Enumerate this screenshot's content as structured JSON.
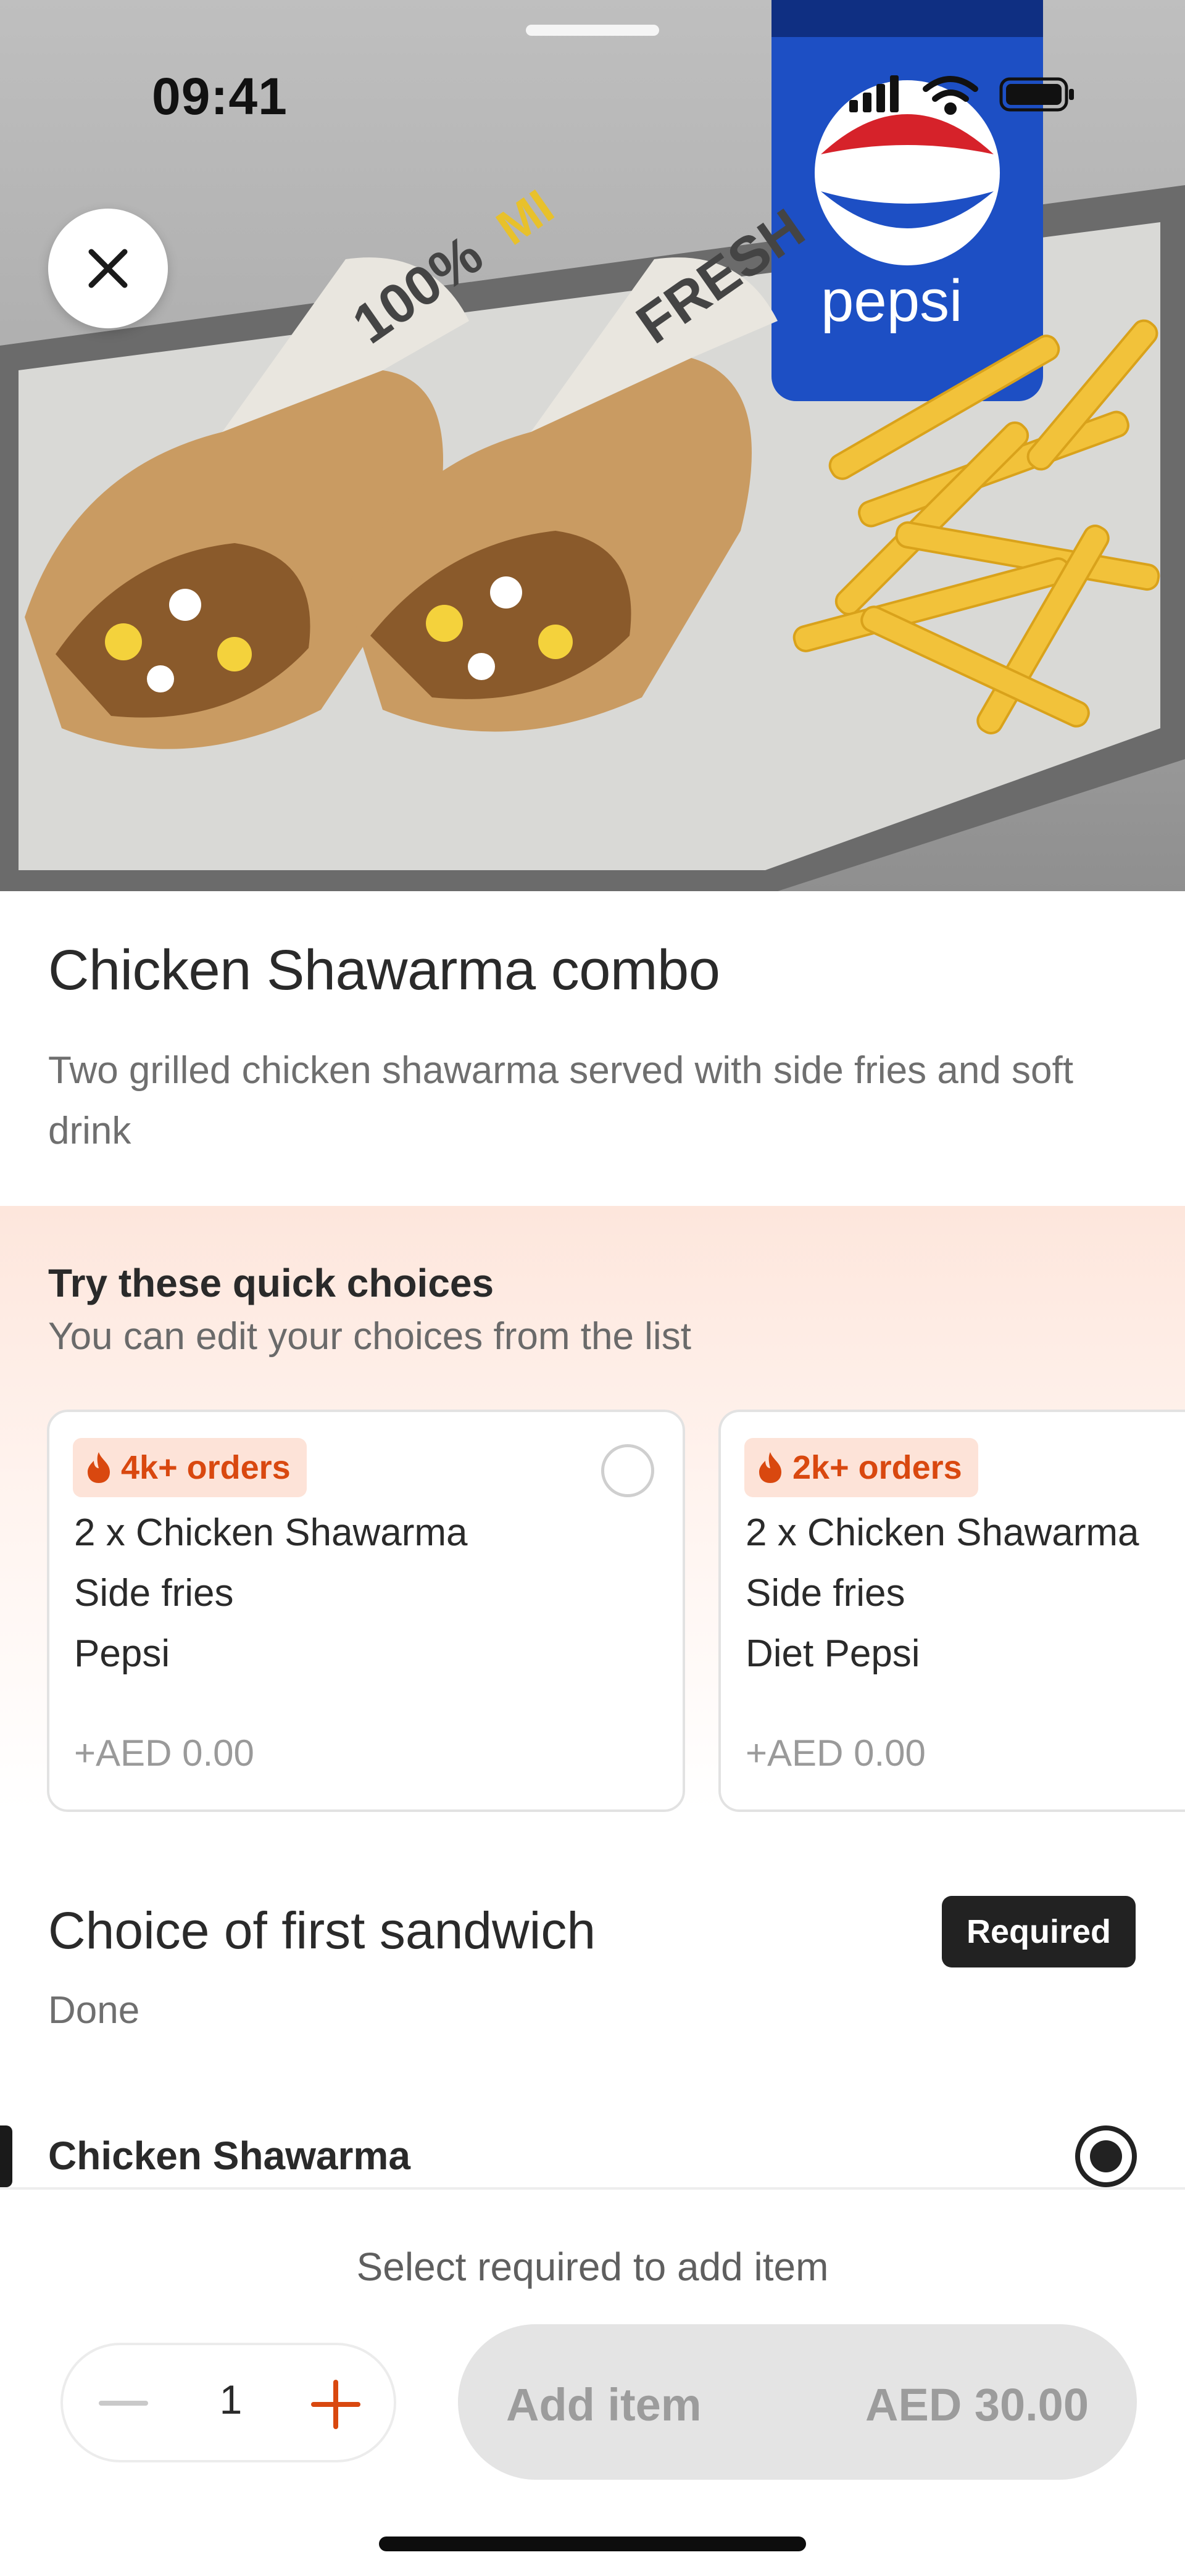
{
  "status_bar": {
    "time": "09:41"
  },
  "hero": {
    "image_alt": "Chicken shawarma combo with fries and Pepsi"
  },
  "item": {
    "title": "Chicken Shawarma combo",
    "description": "Two grilled chicken shawarma served with side fries and soft drink"
  },
  "quick_choices": {
    "title": "Try these quick choices",
    "subtitle": "You can edit your choices from the list",
    "cards": [
      {
        "badge": "4k+ orders",
        "lines": [
          "2 x Chicken Shawarma",
          "Side fries",
          "Pepsi"
        ],
        "price": "+AED 0.00"
      },
      {
        "badge": "2k+ orders",
        "lines": [
          "2 x Chicken Shawarma",
          "Side fries",
          "Diet Pepsi"
        ],
        "price": "+AED 0.00"
      }
    ]
  },
  "section": {
    "title": "Choice of first sandwich",
    "badge": "Required",
    "subtitle": "Done",
    "options": [
      {
        "label": "Chicken Shawarma",
        "selected": true
      }
    ]
  },
  "bottom_bar": {
    "hint": "Select required to add item",
    "quantity": "1",
    "add_label": "Add item",
    "add_price": "AED 30.00"
  },
  "colors": {
    "accent": "#D9480F",
    "badge_bg": "#FDE3D8",
    "required_bg": "#222222",
    "button_disabled": "#E4E4E4"
  },
  "icons": {
    "close": "close-icon",
    "flame": "flame-icon",
    "minus": "minus-icon",
    "plus": "plus-icon"
  }
}
